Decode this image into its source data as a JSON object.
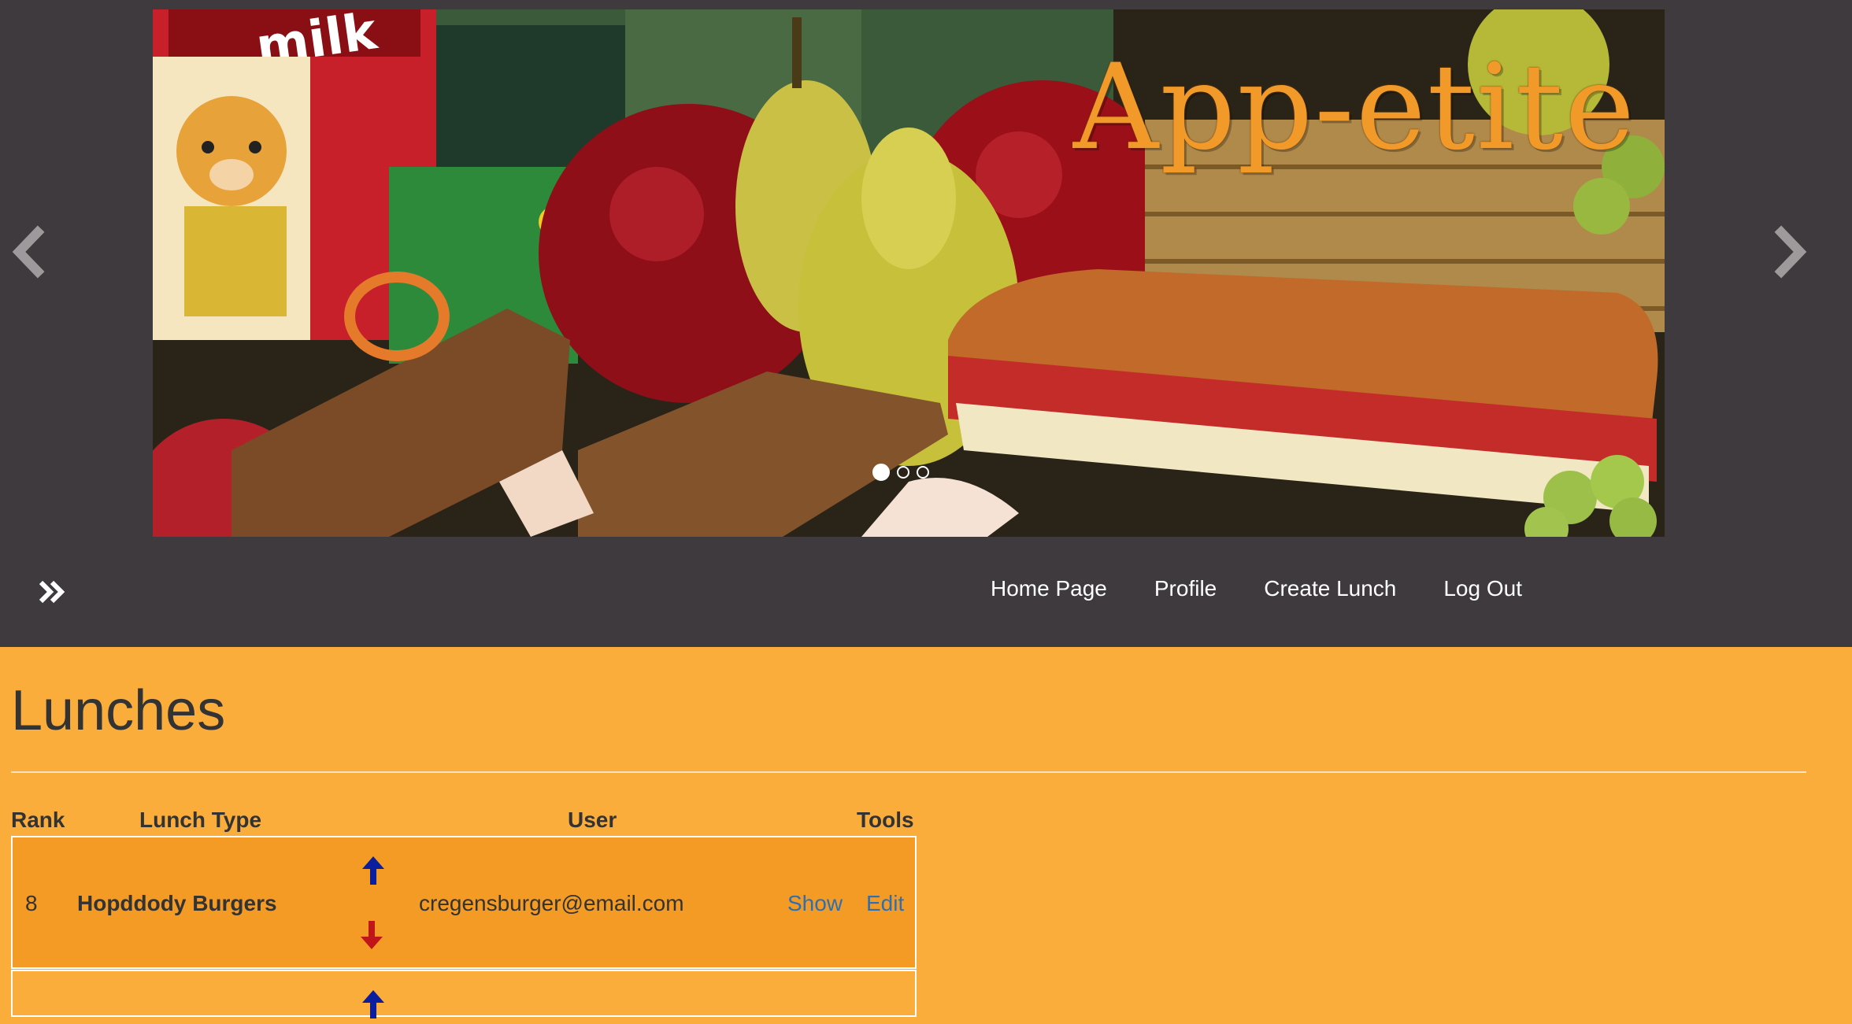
{
  "carousel": {
    "brand_title": "App-etite",
    "slide_count": 3,
    "active_slide": 1,
    "prev_icon": "chevron-left-icon",
    "next_icon": "chevron-right-icon",
    "photo_label": "milk"
  },
  "navbar": {
    "toggle_icon": "double-chevron-right-icon",
    "links": [
      {
        "label": "Home Page"
      },
      {
        "label": "Profile"
      },
      {
        "label": "Create Lunch"
      },
      {
        "label": "Log Out"
      }
    ]
  },
  "main": {
    "title": "Lunches",
    "columns": {
      "rank": "Rank",
      "lunch_type": "Lunch Type",
      "user": "User",
      "tools": "Tools"
    },
    "rows": [
      {
        "rank": "8",
        "lunch_type": "Hopddody Burgers",
        "user": "cregensburger@email.com",
        "show_label": "Show",
        "edit_label": "Edit"
      }
    ]
  },
  "colors": {
    "page_background": "#fbad3b",
    "navbar_background": "#3f3a3d",
    "row_background": "#f49b26",
    "brand_title": "#f19a2a",
    "upvote": "#0a1f9e",
    "downvote": "#c0161a",
    "link": "#2e6fb0"
  }
}
